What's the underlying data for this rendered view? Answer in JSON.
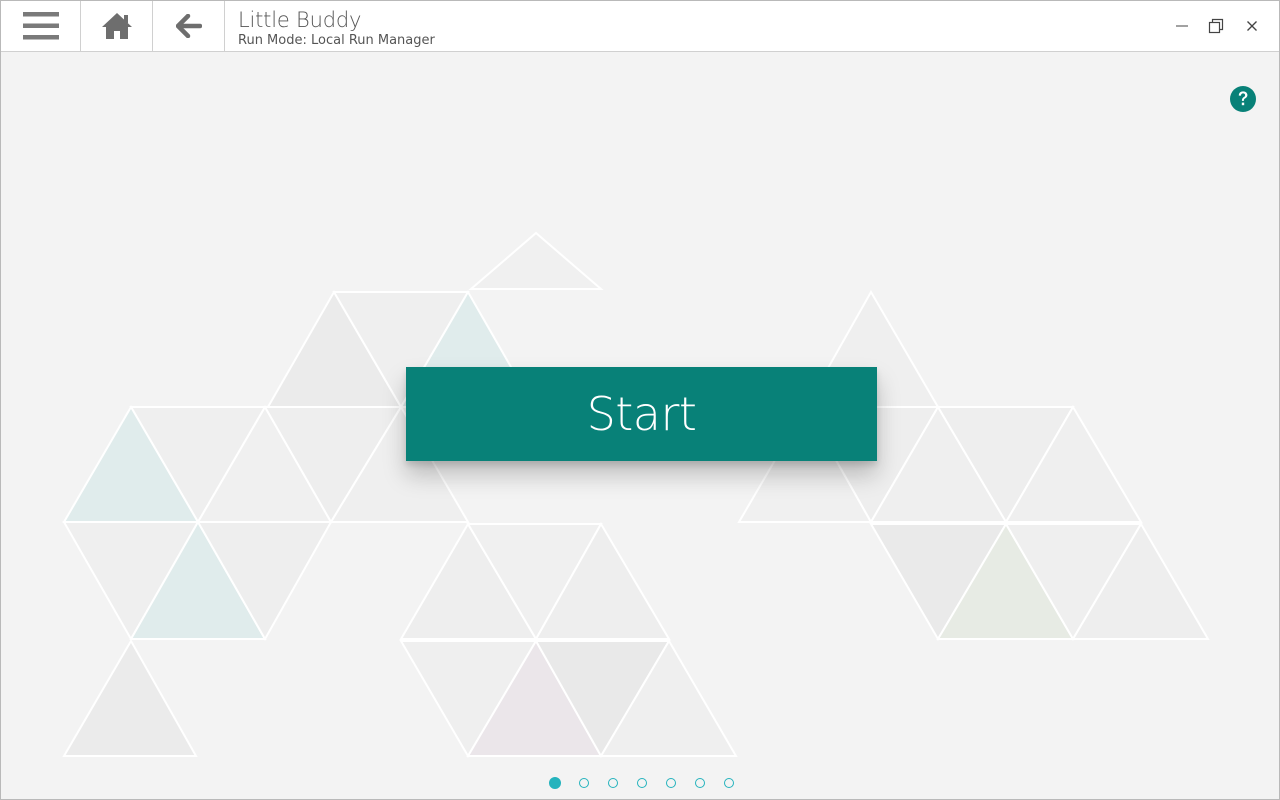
{
  "titlebar": {
    "title": "Little Buddy",
    "subtitle": "Run Mode: Local Run Manager",
    "icons": {
      "menu": "hamburger-menu-icon",
      "home": "home-icon",
      "back": "arrow-left-icon",
      "minimize": "minimize-icon",
      "restore": "restore-icon",
      "close": "close-icon"
    }
  },
  "help": {
    "icon": "question-circle-icon",
    "color": "#088178"
  },
  "main": {
    "start_label": "Start",
    "start_color": "#088178"
  },
  "pager": {
    "count": 7,
    "active_index": 0,
    "color": "#25b3bd"
  }
}
